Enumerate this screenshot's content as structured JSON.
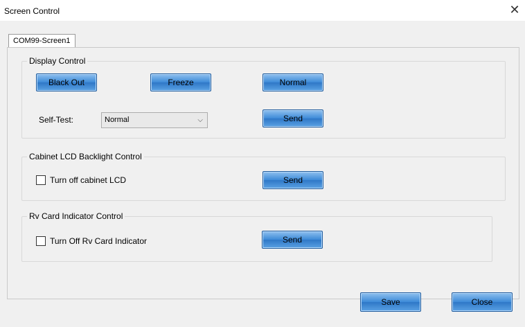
{
  "window": {
    "title": "Screen Control",
    "close_symbol": "✕"
  },
  "tabs": [
    {
      "label": "COM99-Screen1",
      "selected": true
    }
  ],
  "display_control": {
    "legend": "Display Control",
    "black_out_label": "Black Out",
    "freeze_label": "Freeze",
    "normal_label": "Normal",
    "self_test_label": "Self-Test:",
    "self_test_value": "Normal",
    "send_label": "Send"
  },
  "cabinet_lcd": {
    "legend": "Cabinet LCD Backlight Control",
    "checkbox_label": "Turn off cabinet LCD",
    "checked": false,
    "send_label": "Send"
  },
  "rv_card": {
    "legend": "Rv Card Indicator Control",
    "checkbox_label": "Turn Off Rv Card Indicator",
    "checked": false,
    "send_label": "Send"
  },
  "footer": {
    "save_label": "Save",
    "close_label": "Close"
  },
  "colors": {
    "button_top": "#8fc0ee",
    "button_bottom": "#2f78c7",
    "dialog_bg": "#f0f0f0"
  },
  "icons": {
    "window_close": "close-icon",
    "dropdown": "chevron-down-icon",
    "checkbox": "checkbox-icon"
  }
}
